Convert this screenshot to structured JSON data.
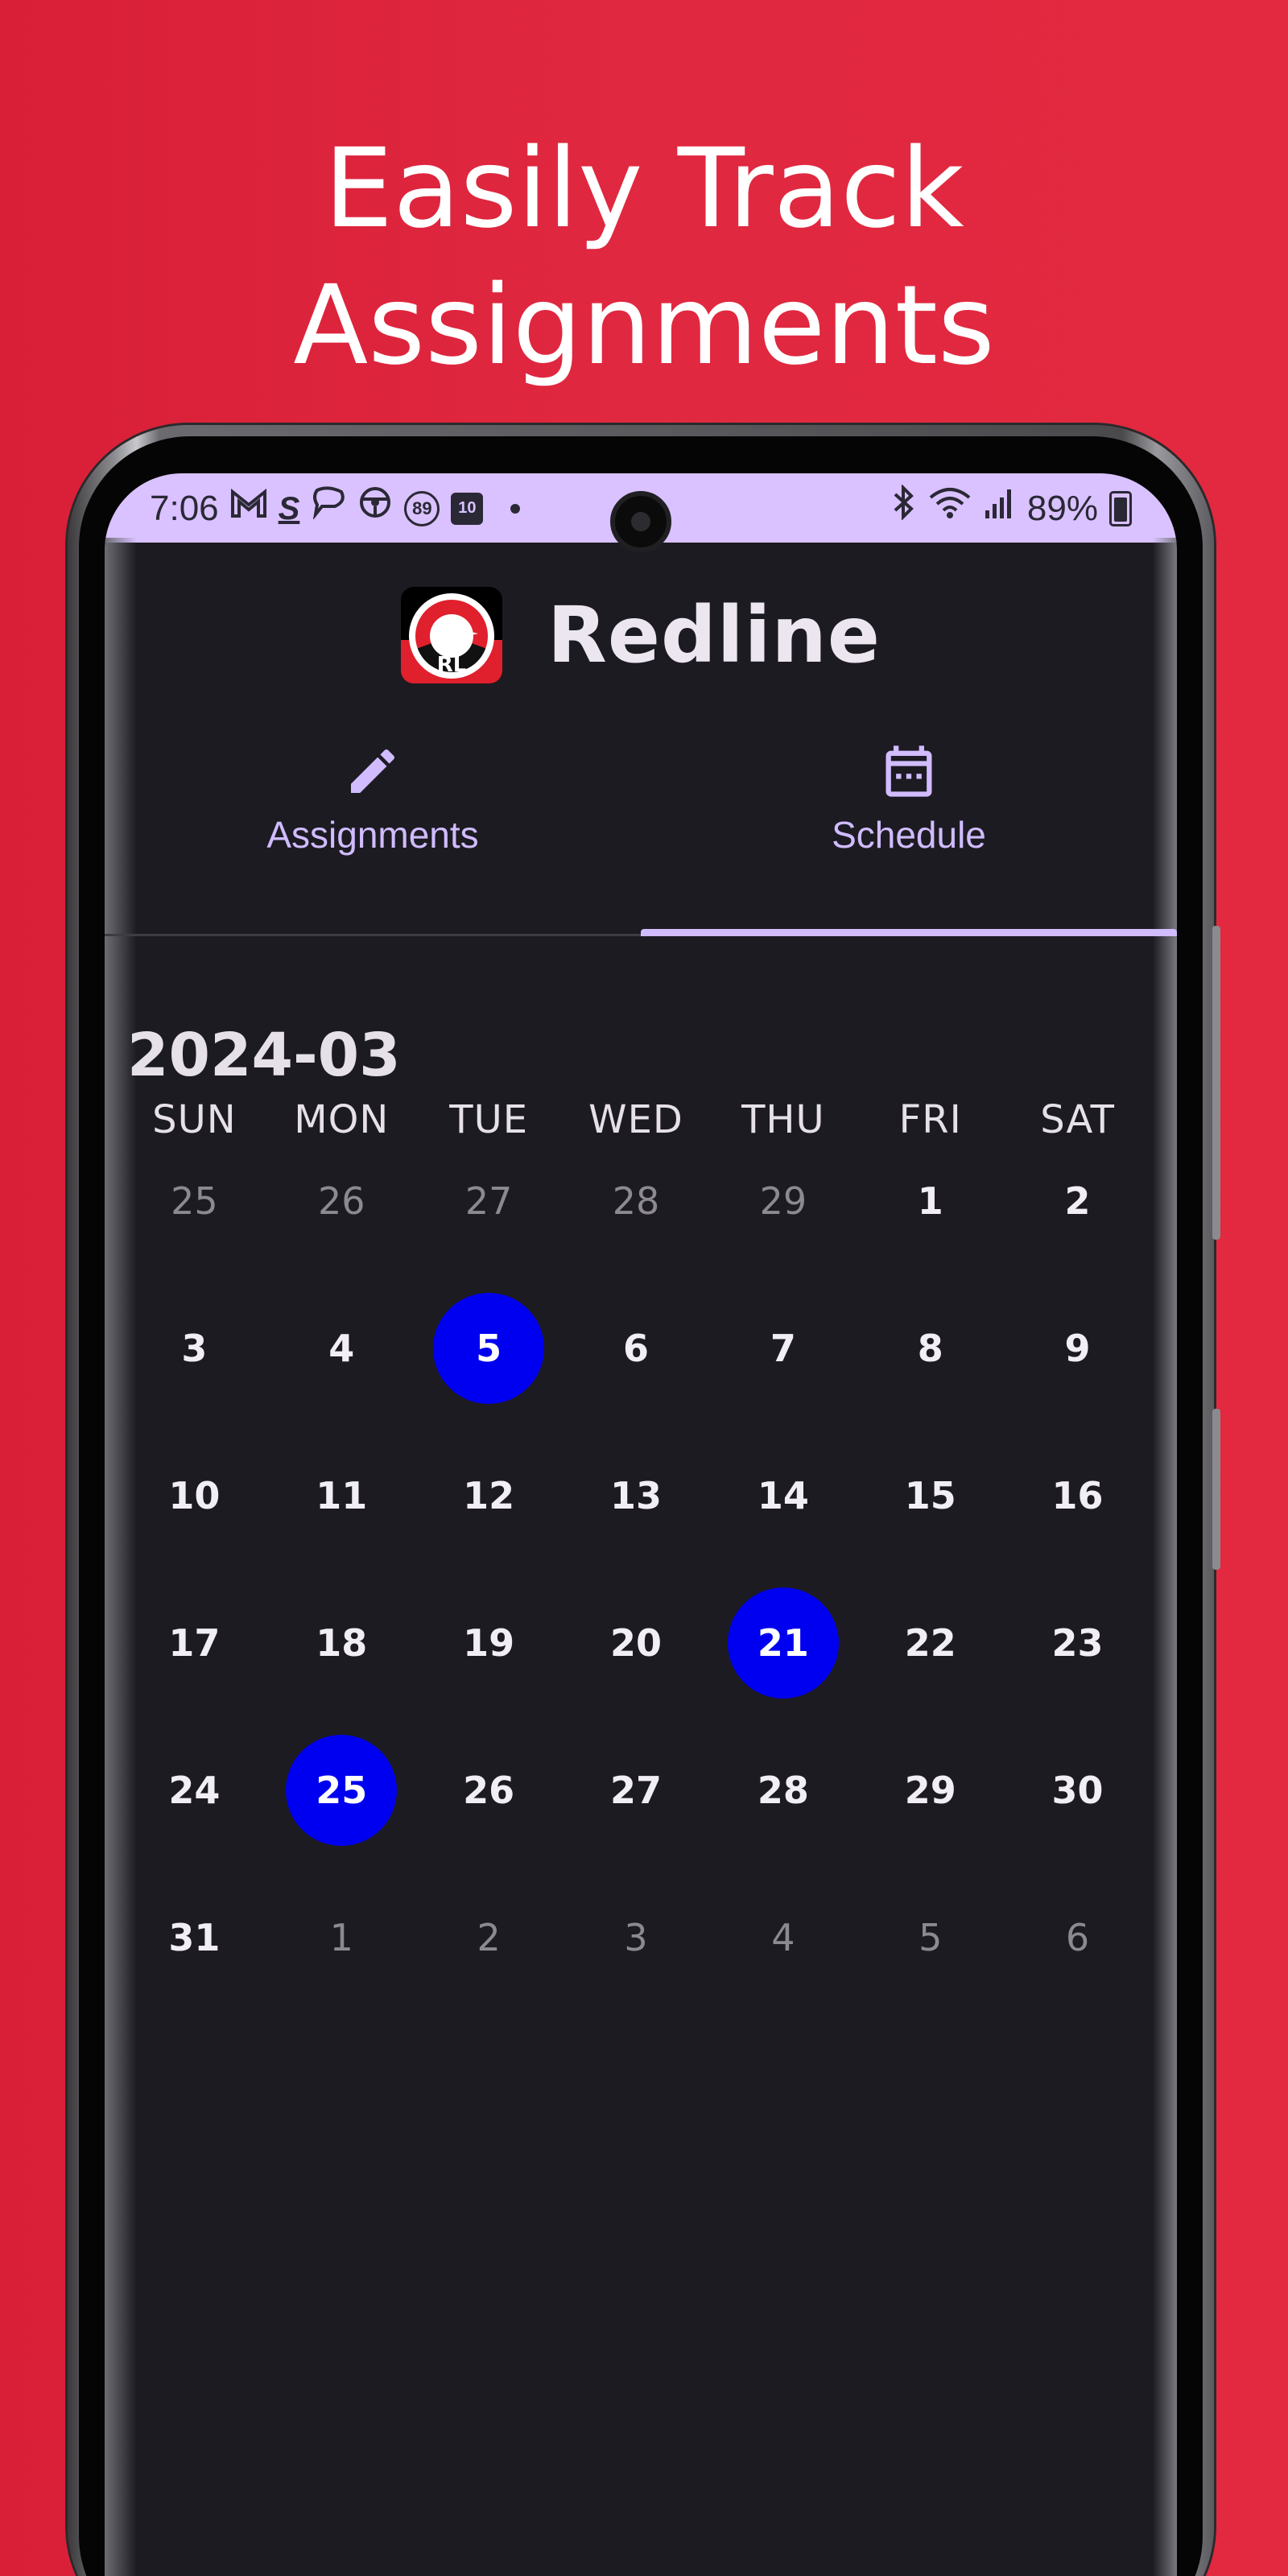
{
  "headline": {
    "line1": "Easily Track",
    "line2": "Assignments"
  },
  "status_bar": {
    "time": "7:06",
    "left_icons": [
      "gmail-icon",
      "s-icon",
      "chat-icon",
      "steering-icon",
      "89-badge-icon",
      "calendar-10-icon"
    ],
    "badge_89": "89",
    "calendar_day": "10",
    "battery": "89%"
  },
  "app": {
    "title": "Redline",
    "logo_text": "RL"
  },
  "tabs": [
    {
      "label": "Assignments",
      "icon": "pencil-icon",
      "selected": false
    },
    {
      "label": "Schedule",
      "icon": "calendar-icon",
      "selected": true
    }
  ],
  "calendar": {
    "month": "2024-03",
    "weekdays": [
      "SUN",
      "MON",
      "TUE",
      "WED",
      "THU",
      "FRI",
      "SAT"
    ],
    "weeks": [
      [
        {
          "d": "25",
          "m": true
        },
        {
          "d": "26",
          "m": true
        },
        {
          "d": "27",
          "m": true
        },
        {
          "d": "28",
          "m": true
        },
        {
          "d": "29",
          "m": true
        },
        {
          "d": "1"
        },
        {
          "d": "2"
        }
      ],
      [
        {
          "d": "3"
        },
        {
          "d": "4"
        },
        {
          "d": "5",
          "e": true
        },
        {
          "d": "6"
        },
        {
          "d": "7"
        },
        {
          "d": "8"
        },
        {
          "d": "9"
        }
      ],
      [
        {
          "d": "10"
        },
        {
          "d": "11"
        },
        {
          "d": "12"
        },
        {
          "d": "13"
        },
        {
          "d": "14"
        },
        {
          "d": "15"
        },
        {
          "d": "16"
        }
      ],
      [
        {
          "d": "17"
        },
        {
          "d": "18"
        },
        {
          "d": "19"
        },
        {
          "d": "20"
        },
        {
          "d": "21",
          "e": true
        },
        {
          "d": "22"
        },
        {
          "d": "23"
        }
      ],
      [
        {
          "d": "24"
        },
        {
          "d": "25",
          "e": true
        },
        {
          "d": "26"
        },
        {
          "d": "27"
        },
        {
          "d": "28"
        },
        {
          "d": "29"
        },
        {
          "d": "30"
        }
      ],
      [
        {
          "d": "31"
        },
        {
          "d": "1",
          "m": true
        },
        {
          "d": "2",
          "m": true
        },
        {
          "d": "3",
          "m": true
        },
        {
          "d": "4",
          "m": true
        },
        {
          "d": "5",
          "m": true
        },
        {
          "d": "6",
          "m": true
        }
      ]
    ],
    "marked_color": "#0000f0"
  },
  "colors": {
    "background": "#e0283f",
    "screen": "#1d1b22",
    "status_bar": "#d9c2ff",
    "accent": "#d0bcff"
  }
}
